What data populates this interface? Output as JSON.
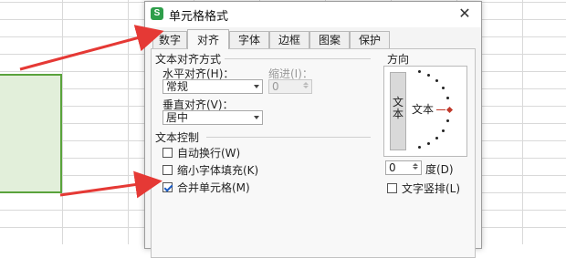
{
  "dialog": {
    "title": "单元格格式",
    "app_icon": "S",
    "close_glyph": "✕"
  },
  "tabs": [
    {
      "label": "数字"
    },
    {
      "label": "对齐"
    },
    {
      "label": "字体"
    },
    {
      "label": "边框"
    },
    {
      "label": "图案"
    },
    {
      "label": "保护"
    }
  ],
  "alignment": {
    "section_label": "文本对齐方式",
    "horizontal_label": "水平对齐(H)：",
    "horizontal_value": "常规",
    "indent_label": "缩进(I)：",
    "indent_value": "0",
    "vertical_label": "垂直对齐(V)：",
    "vertical_value": "居中"
  },
  "text_control": {
    "section_label": "文本控制",
    "wrap_label": "自动换行(W)",
    "wrap_checked": false,
    "shrink_label": "缩小字体填充(K)",
    "shrink_checked": false,
    "merge_label": "合并单元格(M)",
    "merge_checked": true
  },
  "orientation": {
    "section_label": "方向",
    "vertical_text_1": "文",
    "vertical_text_2": "本",
    "dial_label": "文本",
    "degree_value": "0",
    "degree_label": "度(D)",
    "vertical_stack_label": "文字竖排(L)",
    "vertical_stack_checked": false
  },
  "colors": {
    "selection_fill": "#e2efda",
    "selection_border": "#5aa33c",
    "arrow": "#e53935",
    "accent": "#2e9e4a"
  }
}
